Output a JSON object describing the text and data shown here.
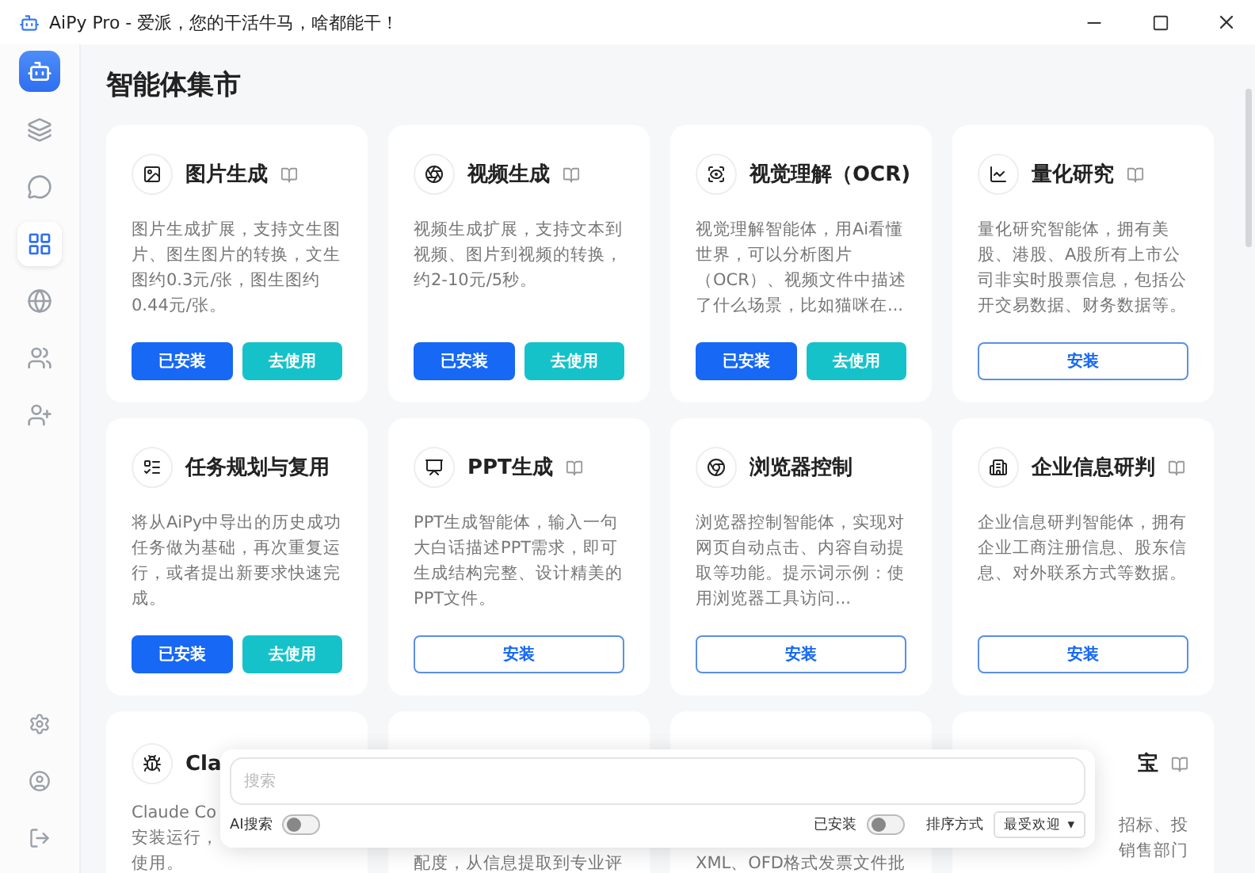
{
  "window": {
    "title": "AiPy Pro - 爱派，您的干活牛马，啥都能干！"
  },
  "sidebar": {
    "items": [
      {
        "selected": false
      },
      {
        "selected": false
      },
      {
        "selected": true
      },
      {
        "selected": false
      },
      {
        "selected": false
      },
      {
        "selected": false
      }
    ]
  },
  "page_title": "智能体集市",
  "cards": [
    {
      "title": "图片生成",
      "doc_badge": true,
      "description": "图片生成扩展，支持文生图片、图生图片的转换，文生图约0.3元/张，图生图约0.44元/张。",
      "buttons": [
        {
          "kind": "installed",
          "label": "已安装"
        },
        {
          "kind": "use",
          "label": "去使用"
        }
      ]
    },
    {
      "title": "视频生成",
      "doc_badge": true,
      "description": "视频生成扩展，支持文本到视频、图片到视频的转换，约2-10元/5秒。",
      "buttons": [
        {
          "kind": "installed",
          "label": "已安装"
        },
        {
          "kind": "use",
          "label": "去使用"
        }
      ]
    },
    {
      "title": "视觉理解（OCR)",
      "doc_badge": false,
      "description": "视觉理解智能体，用Ai看懂世界，可以分析图片（OCR）、视频文件中描述了什么场景，比如猫咪在...",
      "buttons": [
        {
          "kind": "installed",
          "label": "已安装"
        },
        {
          "kind": "use",
          "label": "去使用"
        }
      ]
    },
    {
      "title": "量化研究",
      "doc_badge": true,
      "description": "量化研究智能体，拥有美股、港股、A股所有上市公司非实时股票信息，包括公开交易数据、财务数据等。",
      "buttons": [
        {
          "kind": "install",
          "label": "安装"
        }
      ]
    },
    {
      "title": "任务规划与复用",
      "doc_badge": false,
      "description": "将从AiPy中导出的历史成功任务做为基础，再次重复运行，或者提出新要求快速完成。",
      "buttons": [
        {
          "kind": "installed",
          "label": "已安装"
        },
        {
          "kind": "use",
          "label": "去使用"
        }
      ]
    },
    {
      "title": "PPT生成",
      "doc_badge": true,
      "description": "PPT生成智能体，输入一句大白话描述PPT需求，即可生成结构完整、设计精美的PPT文件。",
      "buttons": [
        {
          "kind": "install",
          "label": "安装"
        }
      ]
    },
    {
      "title": "浏览器控制",
      "doc_badge": false,
      "description": "浏览器控制智能体，实现对网页自动点击、内容自动提取等功能。提示词示例：使用浏览器工具访问...",
      "buttons": [
        {
          "kind": "install",
          "label": "安装"
        }
      ]
    },
    {
      "title": "企业信息研判",
      "doc_badge": true,
      "description": "企业信息研判智能体，拥有企业工商注册信息、股东信息、对外联系方式等数据。",
      "buttons": [
        {
          "kind": "install",
          "label": "安装"
        }
      ]
    }
  ],
  "partial_cards": [
    {
      "title": "Cla",
      "lines": [
        "Claude Co",
        "安装运行，",
        "使用。"
      ]
    },
    {
      "lines": [
        "配度，从信息提取到专业评"
      ]
    },
    {
      "lines": [
        "XML、OFD格式发票文件批"
      ]
    },
    {
      "title": "宝",
      "doc_badge": true,
      "lines": [
        "招标、投",
        "销售部门"
      ]
    }
  ],
  "search_panel": {
    "placeholder": "搜索",
    "ai_search": {
      "label": "AI搜索",
      "on": false
    },
    "installed_filter": {
      "label": "已安装",
      "on": false
    },
    "sort_label": "排序方式",
    "sort_value": "最受欢迎",
    "sort_caret": "▾"
  }
}
